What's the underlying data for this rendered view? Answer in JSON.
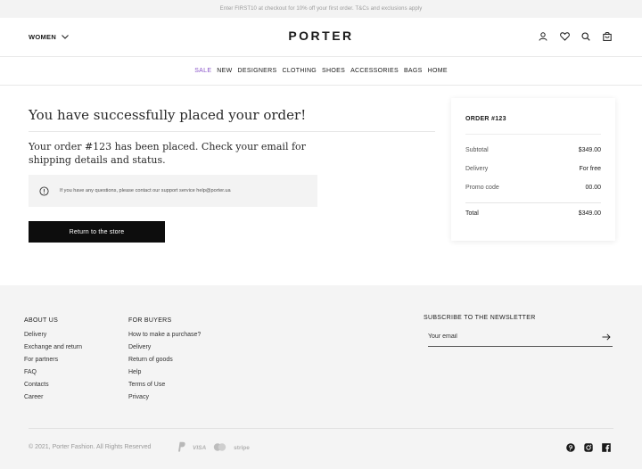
{
  "promo": {
    "text": "Enter FIRST10 at checkout for 10% off your first order. T&Cs and exclusions apply"
  },
  "header": {
    "gender_label": "WOMEN",
    "logo": "PORTER",
    "icons": [
      "user-icon",
      "heart-icon",
      "search-icon",
      "cart-icon"
    ]
  },
  "nav": {
    "items": [
      {
        "label": "SALE",
        "color": "#8a55c9"
      },
      {
        "label": "NEW"
      },
      {
        "label": "DESIGNERS"
      },
      {
        "label": "CLOTHING"
      },
      {
        "label": "SHOES"
      },
      {
        "label": "ACCESSORIES"
      },
      {
        "label": "BAGS"
      },
      {
        "label": "HOME"
      }
    ]
  },
  "confirmation": {
    "title": "You have successfully placed your order!",
    "message": "Your order #123 has been placed. Check your email for shipping details and status.",
    "notice": "If you have any questions, please contact our support service help@porter.ua",
    "button_label": "Return to the store"
  },
  "summary": {
    "order_label": "ORDER #123",
    "rows": [
      {
        "label": "Subtotal",
        "value": "$349.00"
      },
      {
        "label": "Delivery",
        "value": "For free"
      },
      {
        "label": "Promo code",
        "value": "00.00"
      }
    ],
    "total_label": "Total",
    "total_value": "$349.00"
  },
  "footer": {
    "about": {
      "title": "ABOUT US",
      "links": [
        "Delivery",
        "Exchange and return",
        "For partners",
        "FAQ",
        "Contacts",
        "Career"
      ]
    },
    "buyers": {
      "title": "FOR BUYERS",
      "links": [
        "How to make a purchase?",
        "Delivery",
        "Return of goods",
        "Help",
        "Terms of Use",
        "Privacy"
      ]
    },
    "newsletter": {
      "title": "SUBSCRIBE TO THE NEWSLETTER",
      "placeholder": "Your email"
    },
    "copyright": "© 2021, Porter Fashion. All Rights Reserved",
    "payments": [
      "PayPal",
      "VISA",
      "Mastercard",
      "stripe"
    ],
    "socials": [
      "pinterest-icon",
      "instagram-icon",
      "facebook-icon"
    ]
  }
}
